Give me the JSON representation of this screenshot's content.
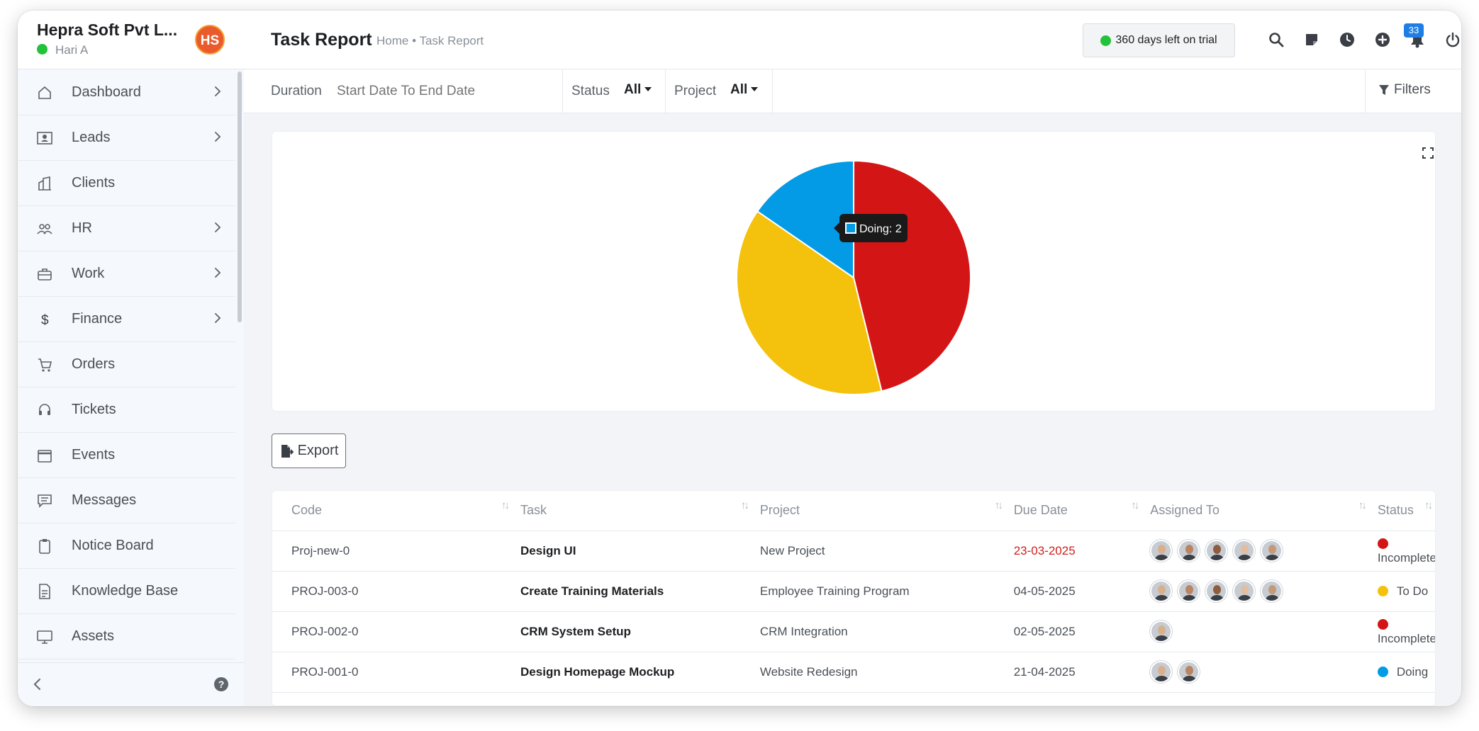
{
  "sidebar": {
    "company": "Hepra Soft Pvt L...",
    "user": "Hari A",
    "logo_text": "HS",
    "items": [
      {
        "label": "Dashboard",
        "icon": "home-icon",
        "chevron": true
      },
      {
        "label": "Leads",
        "icon": "contact-card-icon",
        "chevron": true
      },
      {
        "label": "Clients",
        "icon": "building-icon",
        "chevron": false
      },
      {
        "label": "HR",
        "icon": "people-icon",
        "chevron": true
      },
      {
        "label": "Work",
        "icon": "briefcase-icon",
        "chevron": true
      },
      {
        "label": "Finance",
        "icon": "dollar-icon",
        "chevron": true
      },
      {
        "label": "Orders",
        "icon": "cart-icon",
        "chevron": false
      },
      {
        "label": "Tickets",
        "icon": "headset-icon",
        "chevron": false
      },
      {
        "label": "Events",
        "icon": "calendar-icon",
        "chevron": false
      },
      {
        "label": "Messages",
        "icon": "message-icon",
        "chevron": false
      },
      {
        "label": "Notice Board",
        "icon": "clipboard-icon",
        "chevron": false
      },
      {
        "label": "Knowledge Base",
        "icon": "document-icon",
        "chevron": false
      },
      {
        "label": "Assets",
        "icon": "monitor-icon",
        "chevron": false
      }
    ],
    "help": "?"
  },
  "header": {
    "title": "Task Report",
    "breadcrumb": "Home • Task Report",
    "trial": "360 days left on trial",
    "notification_count": "33",
    "icons": [
      "search-icon",
      "sticky-note-icon",
      "clock-icon",
      "plus-circle-icon",
      "bell-icon",
      "power-icon"
    ]
  },
  "filters": {
    "duration_label": "Duration",
    "duration_placeholder": "Start Date To End Date",
    "status_label": "Status",
    "status_value": "All",
    "project_label": "Project",
    "project_value": "All",
    "filters_label": "Filters"
  },
  "chart_data": {
    "type": "pie",
    "title": "",
    "categories": [
      "Incomplete",
      "To Do",
      "Doing"
    ],
    "values": [
      6,
      5,
      2
    ],
    "colors": [
      "#d41515",
      "#f4c20d",
      "#039be5"
    ],
    "tooltip": "Doing: 2"
  },
  "export_label": "Export",
  "table": {
    "columns": [
      "Code",
      "Task",
      "Project",
      "Due Date",
      "Assigned To",
      "Status"
    ],
    "rows": [
      {
        "code": "Proj-new-0",
        "task": "Design UI",
        "project": "New Project",
        "due": "23-03-2025",
        "overdue": true,
        "assignees": 5,
        "status": "Incomplete",
        "status_color": "#d41515"
      },
      {
        "code": "PROJ-003-0",
        "task": "Create Training Materials",
        "project": "Employee Training Program",
        "due": "04-05-2025",
        "overdue": false,
        "assignees": 5,
        "status": "To Do",
        "status_color": "#f4c20d"
      },
      {
        "code": "PROJ-002-0",
        "task": "CRM System Setup",
        "project": "CRM Integration",
        "due": "02-05-2025",
        "overdue": false,
        "assignees": 1,
        "status": "Incomplete",
        "status_color": "#d41515"
      },
      {
        "code": "PROJ-001-0",
        "task": "Design Homepage Mockup",
        "project": "Website Redesign",
        "due": "21-04-2025",
        "overdue": false,
        "assignees": 2,
        "status": "Doing",
        "status_color": "#039be5"
      }
    ]
  }
}
